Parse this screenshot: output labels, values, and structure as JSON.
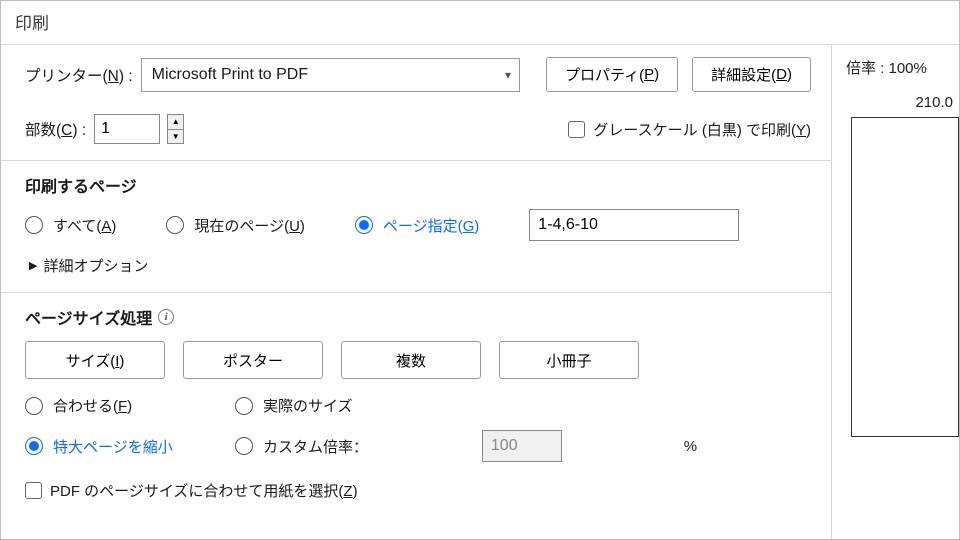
{
  "title": "印刷",
  "printer": {
    "label_pre": "プリンター(",
    "label_key": "N",
    "label_post": ") :",
    "selected": "Microsoft Print to PDF",
    "properties_btn_pre": "プロパティ(",
    "properties_btn_key": "P",
    "properties_btn_post": ")",
    "advanced_btn_pre": "詳細設定(",
    "advanced_btn_key": "D",
    "advanced_btn_post": ")"
  },
  "copies": {
    "label_pre": "部数(",
    "label_key": "C",
    "label_post": ") :",
    "value": "1"
  },
  "grayscale": {
    "label_pre": "グレースケール (白黒) で印刷(",
    "label_key": "Y",
    "label_post": ")",
    "checked": false
  },
  "pages": {
    "group_title": "印刷するページ",
    "all_pre": "すべて(",
    "all_key": "A",
    "all_post": ")",
    "current_pre": "現在のページ(",
    "current_key": "U",
    "current_post": ")",
    "range_pre": "ページ指定(",
    "range_key": "G",
    "range_post": ")",
    "range_value": "1-4,6-10",
    "selected": "range",
    "more_options": "詳細オプション"
  },
  "sizing": {
    "group_title": "ページサイズ処理",
    "tabs": {
      "size_pre": "サイズ(",
      "size_key": "I",
      "size_post": ")",
      "poster": "ポスター",
      "multiple": "複数",
      "booklet": "小冊子"
    },
    "fit_pre": "合わせる(",
    "fit_key": "F",
    "fit_post": ")",
    "actual": "実際のサイズ",
    "shrink": "特大ページを縮小",
    "custom": "カスタム倍率：",
    "custom_value": "100",
    "custom_unit": "%",
    "selected": "shrink",
    "choose_paper_pre": "PDF のページサイズに合わせて用紙を選択(",
    "choose_paper_key": "Z",
    "choose_paper_post": ")"
  },
  "preview": {
    "scale_label": "倍率 : 100%",
    "dimension": "210.0"
  }
}
